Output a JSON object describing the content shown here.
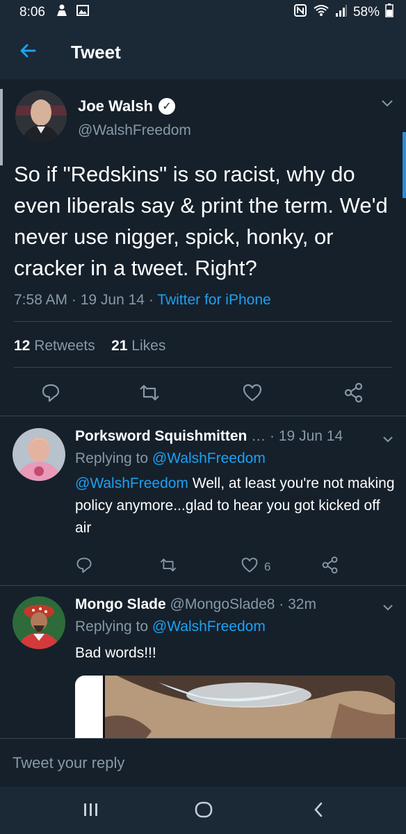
{
  "status_bar": {
    "time": "8:06",
    "battery": "58%",
    "icons": [
      "person-icon",
      "image-icon",
      "nfc-icon",
      "wifi-icon",
      "signal-icon",
      "battery-icon"
    ]
  },
  "app_bar": {
    "title": "Tweet",
    "back_icon": "arrow-left-icon"
  },
  "main_tweet": {
    "name": "Joe Walsh",
    "handle": "@WalshFreedom",
    "text": "So if \"Redskins\" is so racist, why do even liberals say & print the term. We'd never use nigger, spick, honky, or cracker in a tweet. Right?",
    "time": "7:58 AM",
    "date": "19 Jun 14",
    "source": "Twitter for iPhone",
    "retweets_count": "12",
    "retweets_label": "Retweets",
    "likes_count": "21",
    "likes_label": "Likes"
  },
  "replies": [
    {
      "name": "Porksword Squishmitten",
      "meta": "… · 19 Jun 14",
      "replying_prefix": "Replying to",
      "replying_handle": "@WalshFreedom",
      "mention": "@WalshFreedom",
      "text": "Well, at least you're not making policy anymore...glad to hear you got kicked off air",
      "likes": "6"
    },
    {
      "name": "Mongo Slade",
      "meta": "@MongoSlade8 · 32m",
      "replying_prefix": "Replying to",
      "replying_handle": "@WalshFreedom",
      "text": "Bad words!!!"
    }
  ],
  "reply_box": {
    "placeholder": "Tweet your reply"
  },
  "colors": {
    "background": "#15202b",
    "bar": "#1b2836",
    "accent": "#1da1f2",
    "secondary_text": "#8899a6",
    "divider": "#38444d"
  }
}
